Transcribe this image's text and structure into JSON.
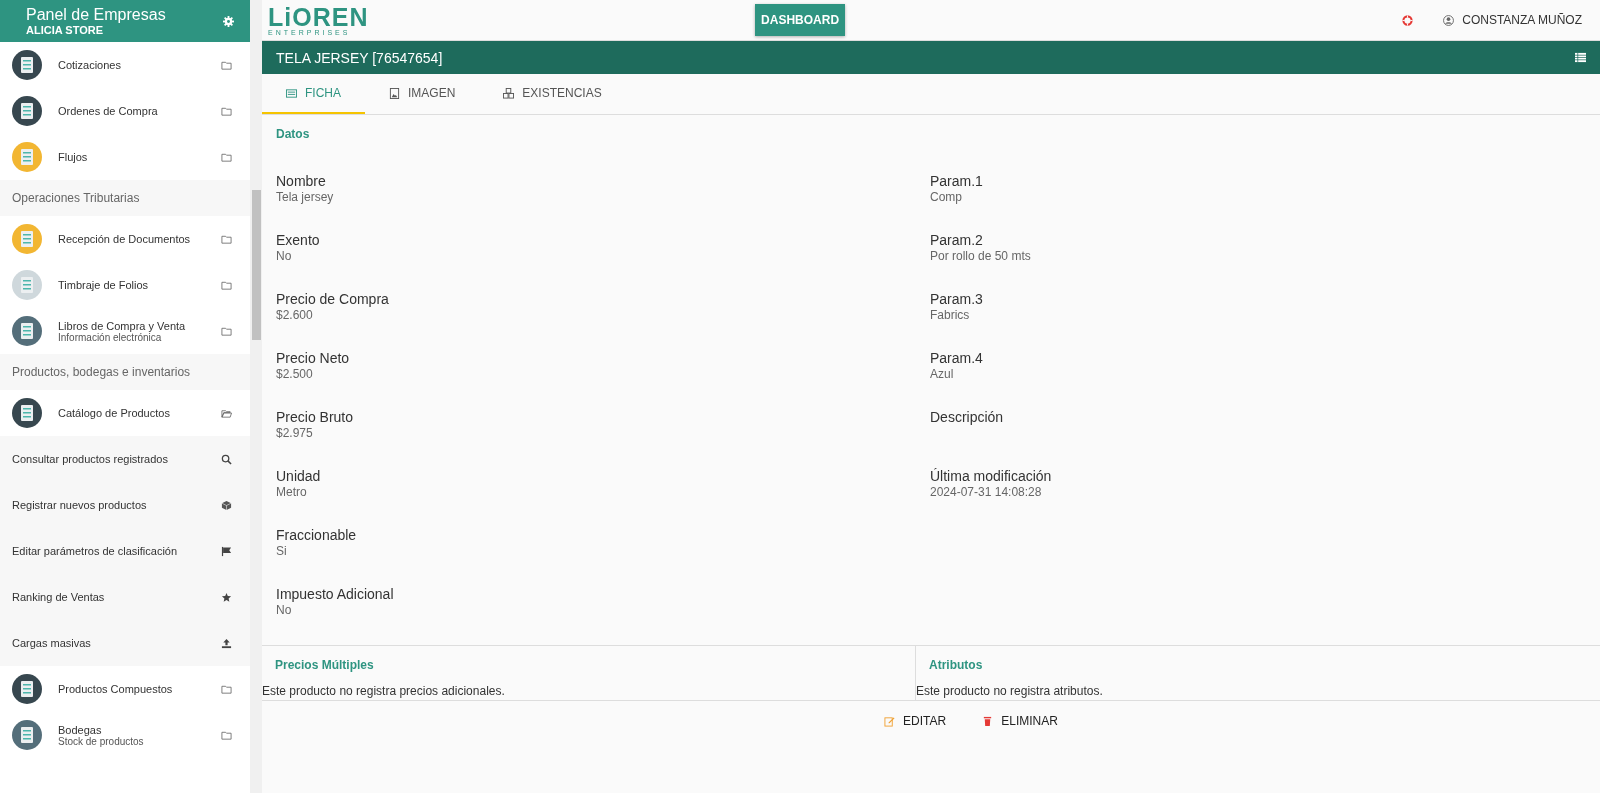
{
  "sidebar": {
    "title": "Panel de Empresas",
    "subtitle": "ALICIA STORE",
    "items": [
      {
        "kind": "app",
        "label": "Cotizaciones",
        "expanded": false
      },
      {
        "kind": "app",
        "label": "Ordenes de Compra",
        "expanded": false
      },
      {
        "kind": "app",
        "label": "Flujos",
        "expanded": false
      },
      {
        "kind": "section",
        "label": "Operaciones Tributarias"
      },
      {
        "kind": "app",
        "label": "Recepción de Documentos",
        "expanded": false
      },
      {
        "kind": "app",
        "label": "Timbraje de Folios",
        "expanded": false
      },
      {
        "kind": "app",
        "label": "Libros de Compra y Venta",
        "sublabel": "Información electrónica",
        "expanded": false
      },
      {
        "kind": "section",
        "label": "Productos, bodegas e inventarios"
      },
      {
        "kind": "app",
        "label": "Catálogo de Productos",
        "expanded": true
      },
      {
        "kind": "action",
        "label": "Consultar productos registrados"
      },
      {
        "kind": "action",
        "label": "Registrar nuevos productos"
      },
      {
        "kind": "action",
        "label": "Editar parámetros de clasificación"
      },
      {
        "kind": "action",
        "label": "Ranking de Ventas"
      },
      {
        "kind": "action",
        "label": "Cargas masivas"
      },
      {
        "kind": "app",
        "label": "Productos Compuestos",
        "expanded": false
      },
      {
        "kind": "app",
        "label": "Bodegas",
        "sublabel": "Stock de productos",
        "expanded": false
      }
    ]
  },
  "topbar": {
    "logo": "LiOREN",
    "logo_sub": "ENTERPRISES",
    "dashboard": "DASHBOARD",
    "user": "CONSTANZA MUÑOZ"
  },
  "title": "TELA JERSEY [76547654]",
  "tabs": [
    {
      "label": "FICHA",
      "selected": true
    },
    {
      "label": "IMAGEN",
      "selected": false
    },
    {
      "label": "EXISTENCIAS",
      "selected": false
    }
  ],
  "section_title": "Datos",
  "fields_left": [
    {
      "label": "Nombre",
      "value": "Tela jersey"
    },
    {
      "label": "Exento",
      "value": "No"
    },
    {
      "label": "Precio de Compra",
      "value": "$2.600"
    },
    {
      "label": "Precio Neto",
      "value": "$2.500"
    },
    {
      "label": "Precio Bruto",
      "value": "$2.975"
    },
    {
      "label": "Unidad",
      "value": "Metro"
    },
    {
      "label": "Fraccionable",
      "value": "Si"
    },
    {
      "label": "Impuesto Adicional",
      "value": "No"
    }
  ],
  "fields_right": [
    {
      "label": "Param.1",
      "value": "Comp"
    },
    {
      "label": "Param.2",
      "value": "Por rollo de 50 mts"
    },
    {
      "label": "Param.3",
      "value": "Fabrics"
    },
    {
      "label": "Param.4",
      "value": "Azul"
    },
    {
      "label": "Descripción"
    },
    {
      "label": "Última modificación",
      "value": "2024-07-31 14:08:28"
    }
  ],
  "panels": [
    {
      "title": "Precios Múltiples",
      "text": "Este producto no registra precios adicionales."
    },
    {
      "title": "Atributos",
      "text": "Este producto no registra atributos."
    }
  ],
  "actions": [
    {
      "kind": "edit",
      "label": "EDITAR"
    },
    {
      "kind": "delete",
      "label": "ELIMINAR"
    }
  ]
}
